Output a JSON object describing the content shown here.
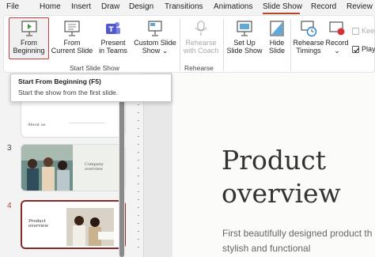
{
  "tabs": [
    "File",
    "Home",
    "Insert",
    "Draw",
    "Design",
    "Transitions",
    "Animations",
    "Slide Show",
    "Record",
    "Review"
  ],
  "active_tab": "Slide Show",
  "accent_color": "#b7472a",
  "ribbon": {
    "start_group": {
      "label": "Start Slide Show",
      "from_beginning": [
        "From",
        "Beginning"
      ],
      "from_current": [
        "From",
        "Current Slide"
      ],
      "present_teams": [
        "Present",
        "in Teams"
      ],
      "custom_show": [
        "Custom Slide",
        "Show ⌄"
      ]
    },
    "rehearse_group": {
      "label": "Rehearse",
      "rehearse_coach": [
        "Rehearse",
        "with Coach"
      ]
    },
    "setup_group": {
      "setup_show": [
        "Set Up",
        "Slide Show"
      ],
      "hide_slide": [
        "Hide",
        "Slide"
      ],
      "rehearse_timings": [
        "Rehearse",
        "Timings"
      ],
      "record": [
        "Record",
        "⌄"
      ],
      "keep_label": "Keep",
      "play_label": "Play"
    }
  },
  "tooltip": {
    "title": "Start From Beginning (F5)",
    "description": "Start the show from the first slide."
  },
  "thumbnails": [
    {
      "number": "",
      "text": "About us"
    },
    {
      "number": "3",
      "text": "Company overview"
    },
    {
      "number": "4",
      "text": "Product overview"
    }
  ],
  "slide": {
    "title_line1": "Product",
    "title_line2": "overview",
    "subtitle_line1": "First beautifully designed product th",
    "subtitle_line2": "stylish and functional"
  }
}
